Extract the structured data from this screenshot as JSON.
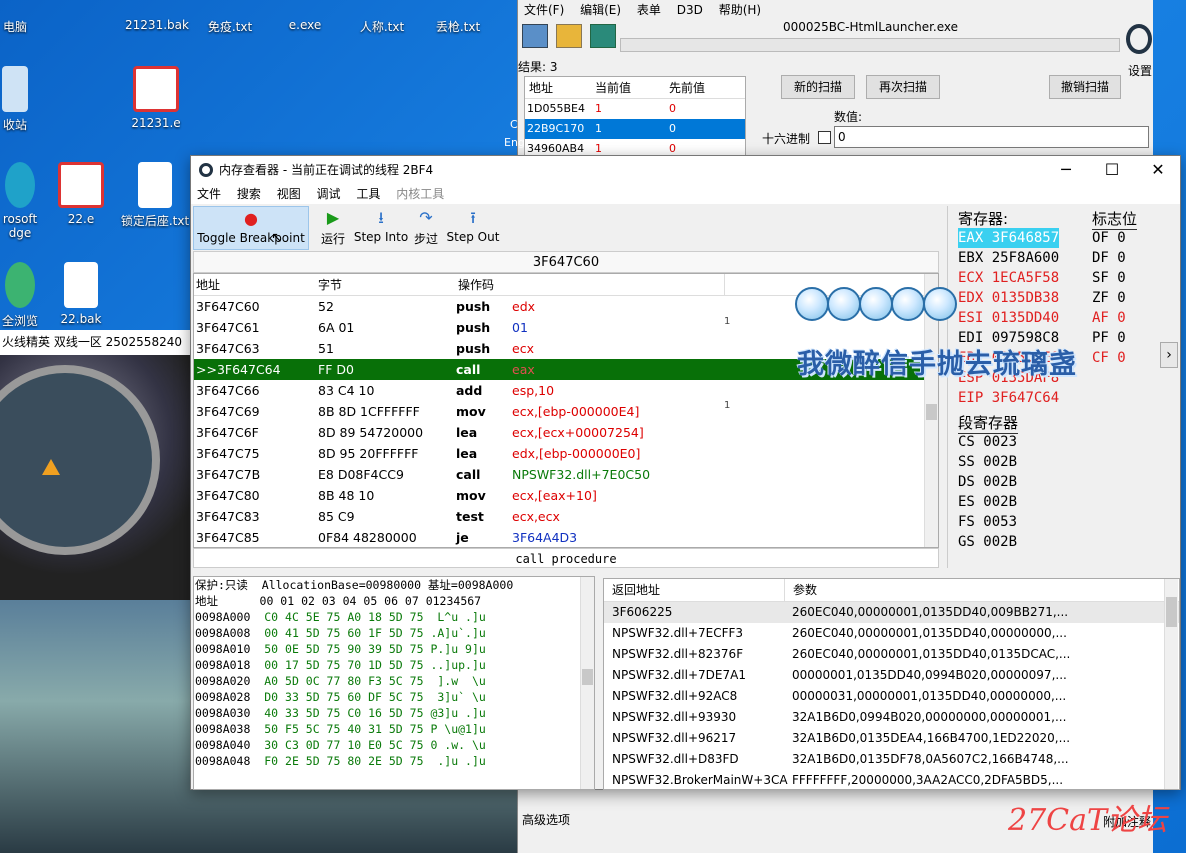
{
  "desktop": {
    "icons": [
      {
        "label": "电脑",
        "name": "desktop-icon-computer"
      },
      {
        "label": "21231.bak",
        "name": "desktop-icon-21231-bak"
      },
      {
        "label": "免疫.txt",
        "name": "desktop-icon-mianyi"
      },
      {
        "label": "e.exe",
        "name": "desktop-icon-e-exe"
      },
      {
        "label": "人称.txt",
        "name": "desktop-icon-rencheng"
      },
      {
        "label": "丢枪.txt",
        "name": "desktop-icon-diuqiang"
      },
      {
        "label": "收站",
        "name": "desktop-icon-recycle"
      },
      {
        "label": "21231.e",
        "name": "desktop-icon-21231-e"
      },
      {
        "label": "rosoft",
        "name": "desktop-icon-edge"
      },
      {
        "label": "dge",
        "name": "desktop-icon-edge-2"
      },
      {
        "label": "22.e",
        "name": "desktop-icon-22-e"
      },
      {
        "label": "锁定后座.txt",
        "name": "desktop-icon-suoding"
      },
      {
        "label": "全浏览",
        "name": "desktop-icon-browser"
      },
      {
        "label": "22.bak",
        "name": "desktop-icon-22-bak"
      }
    ],
    "game_title": "火线精英 双线一区 2502558240"
  },
  "ce": {
    "menu": [
      "文件(F)",
      "编辑(E)",
      "表单",
      "D3D",
      "帮助(H)"
    ],
    "process": "000025BC-HtmlLauncher.exe",
    "settings": "设置",
    "found": "结果: 3",
    "list_headers": [
      "地址",
      "当前值",
      "先前值"
    ],
    "list_rows": [
      {
        "addr": "1D055BE4",
        "cur": "1",
        "prev": "0"
      },
      {
        "addr": "22B9C170",
        "cur": "1",
        "prev": "0"
      },
      {
        "addr": "34960AB4",
        "cur": "1",
        "prev": "0"
      }
    ],
    "new_scan": "新的扫描",
    "next_scan": "再次扫描",
    "undo_scan": "撤销扫描",
    "value_label": "数值:",
    "hex_label": "十六进制",
    "value_input": "0",
    "advanced": "高级选项",
    "eng": "Eng",
    "mid_c": "C",
    "bottom_right": "附加注释"
  },
  "mv": {
    "title": "内存查看器 - 当前正在调试的线程 2BF4",
    "menu": [
      "文件",
      "搜索",
      "视图",
      "调试",
      "工具",
      "内核工具"
    ],
    "toolbar": [
      "Toggle Breakpoint",
      "运行",
      "Step Into",
      "步过",
      "Step Out"
    ],
    "address": "3F647C60",
    "dis_headers": [
      "地址",
      "字节",
      "操作码"
    ],
    "rows": [
      {
        "a": "3F647C60",
        "b": "52",
        "op": "push",
        "arg": "edx",
        "cls": "red"
      },
      {
        "a": "3F647C61",
        "b": "6A 01",
        "op": "push",
        "arg": "01",
        "cls": "blue"
      },
      {
        "a": "3F647C63",
        "b": "51",
        "op": "push",
        "arg": "ecx",
        "cls": "red"
      },
      {
        "a": ">>3F647C64",
        "b": "FF D0",
        "op": "call",
        "arg": "eax",
        "cls": "red"
      },
      {
        "a": "3F647C66",
        "b": "83 C4 10",
        "op": "add",
        "arg": "esp,10",
        "cls": "red"
      },
      {
        "a": "3F647C69",
        "b": "8B 8D 1CFFFFFF",
        "op": "mov",
        "arg": "ecx,[ebp-000000E4]",
        "cls": "red"
      },
      {
        "a": "3F647C6F",
        "b": "8D 89 54720000",
        "op": "lea",
        "arg": "ecx,[ecx+00007254]",
        "cls": "red"
      },
      {
        "a": "3F647C75",
        "b": "8D 95 20FFFFFF",
        "op": "lea",
        "arg": "edx,[ebp-000000E0]",
        "cls": "red"
      },
      {
        "a": "3F647C7B",
        "b": "E8 D08F4CC9",
        "op": "call",
        "arg": "NPSWF32.dll+7E0C50",
        "cls": "green"
      },
      {
        "a": "3F647C80",
        "b": "8B 48 10",
        "op": "mov",
        "arg": "ecx,[eax+10]",
        "cls": "red"
      },
      {
        "a": "3F647C83",
        "b": "85 C9",
        "op": "test",
        "arg": "ecx,ecx",
        "cls": "red"
      },
      {
        "a": "3F647C85",
        "b": "0F84 48280000",
        "op": "je",
        "arg": "3F64A4D3",
        "cls": "blue"
      }
    ],
    "comment_marks": [
      "1",
      "1"
    ],
    "desc": "call procedure",
    "registers_title": "寄存器:",
    "flags_title": "标志位",
    "regs": [
      {
        "n": "EAX",
        "v": "3F646857",
        "hl": true
      },
      {
        "n": "EBX",
        "v": "25F8A600"
      },
      {
        "n": "ECX",
        "v": "1ECA5F58",
        "red": true
      },
      {
        "n": "EDX",
        "v": "0135DB38",
        "red": true
      },
      {
        "n": "ESI",
        "v": "0135DD40",
        "red": true
      },
      {
        "n": "EDI",
        "v": "097598C8"
      },
      {
        "n": "EBP",
        "v": "0135DBE0",
        "red": true
      },
      {
        "n": "ESP",
        "v": "0135DAF8",
        "red": true
      },
      {
        "n": "EIP",
        "v": "3F647C64",
        "red": true
      }
    ],
    "flags": [
      {
        "n": "OF",
        "v": "0"
      },
      {
        "n": "DF",
        "v": "0"
      },
      {
        "n": "SF",
        "v": "0"
      },
      {
        "n": "ZF",
        "v": "0"
      },
      {
        "n": "AF",
        "v": "0",
        "red": true
      },
      {
        "n": "PF",
        "v": "0"
      },
      {
        "n": "CF",
        "v": "0",
        "red": true
      }
    ],
    "seg_title": "段寄存器",
    "segs": [
      {
        "n": "CS",
        "v": "0023"
      },
      {
        "n": "SS",
        "v": "002B"
      },
      {
        "n": "DS",
        "v": "002B"
      },
      {
        "n": "ES",
        "v": "002B"
      },
      {
        "n": "FS",
        "v": "0053"
      },
      {
        "n": "GS",
        "v": "002B"
      }
    ],
    "hex_header1": "保护:只读  AllocationBase=00980000 基址=0098A000",
    "hex_header2": "地址      00 01 02 03 04 05 06 07 01234567",
    "hex_rows": [
      {
        "a": "0098A000",
        "b": "C0 4C 5E 75 A0 18 5D 75",
        "t": " L^u .]u"
      },
      {
        "a": "0098A008",
        "b": "00 41 5D 75 60 1F 5D 75",
        "t": ".A]u`.]u"
      },
      {
        "a": "0098A010",
        "b": "50 0E 5D 75 90 39 5D 75",
        "t": "P.]u 9]u"
      },
      {
        "a": "0098A018",
        "b": "00 17 5D 75 70 1D 5D 75",
        "t": "..]up.]u"
      },
      {
        "a": "0098A020",
        "b": "A0 5D 0C 77 80 F3 5C 75",
        "t": " ].w  \\u"
      },
      {
        "a": "0098A028",
        "b": "D0 33 5D 75 60 DF 5C 75",
        "t": " 3]u` \\u"
      },
      {
        "a": "0098A030",
        "b": "40 33 5D 75 C0 16 5D 75",
        "t": "@3]u .]u"
      },
      {
        "a": "0098A038",
        "b": "50 F5 5C 75 40 31 5D 75",
        "t": "P \\u@1]u"
      },
      {
        "a": "0098A040",
        "b": "30 C3 0D 77 10 E0 5C 75",
        "t": "0 .w. \\u"
      },
      {
        "a": "0098A048",
        "b": "F0 2E 5D 75 80 2E 5D 75",
        "t": " .]u .]u"
      }
    ],
    "stack_headers": [
      "返回地址",
      "参数"
    ],
    "stack_rows": [
      {
        "r": "3F606225",
        "p": "260EC040,00000001,0135DD40,009BB271,..."
      },
      {
        "r": "NPSWF32.dll+7ECFF3",
        "p": "260EC040,00000001,0135DD40,00000000,..."
      },
      {
        "r": "NPSWF32.dll+82376F",
        "p": "260EC040,00000001,0135DD40,0135DCAC,..."
      },
      {
        "r": "NPSWF32.dll+7DE7A1",
        "p": "00000001,0135DD40,0994B020,00000097,..."
      },
      {
        "r": "NPSWF32.dll+92AC8",
        "p": "00000031,00000001,0135DD40,00000000,..."
      },
      {
        "r": "NPSWF32.dll+93930",
        "p": "32A1B6D0,0994B020,00000000,00000001,..."
      },
      {
        "r": "NPSWF32.dll+96217",
        "p": "32A1B6D0,0135DEA4,166B4700,1ED22020,..."
      },
      {
        "r": "NPSWF32.dll+D83FD",
        "p": "32A1B6D0,0135DF78,0A5607C2,166B4748,..."
      },
      {
        "r": "NPSWF32.BrokerMainW+3CA",
        "p": "FFFFFFFF,20000000,3AA2ACC0,2DFA5BD5,..."
      }
    ]
  },
  "overlay_text": "我微醉信手抛去琉璃盏",
  "watermark": "27CaT论坛"
}
